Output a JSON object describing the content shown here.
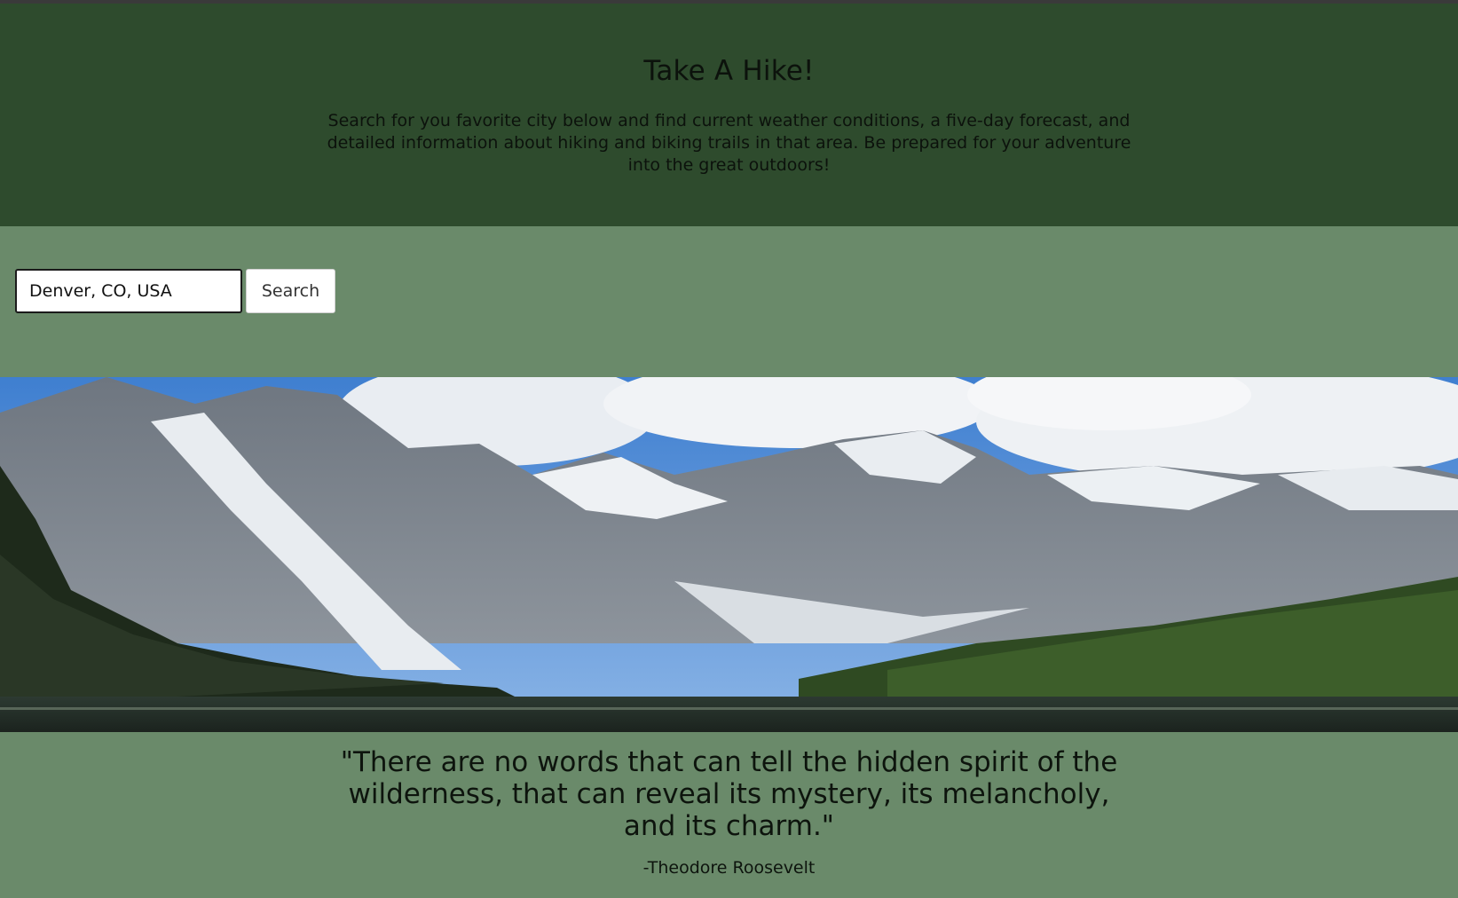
{
  "header": {
    "title": "Take A Hike!",
    "description": "Search for you favorite city below and find current weather conditions, a five-day forecast, and detailed information about hiking and biking trails in that area. Be prepared for your adventure into the great outdoors!"
  },
  "search": {
    "value": "Denver, CO, USA",
    "button_label": "Search"
  },
  "hero": {
    "image": "mountain-lake-landscape"
  },
  "quote": {
    "text": "\"There are no words that can tell the hidden spirit of the wilderness, that can reveal its mystery, its melancholy, and its charm.\"",
    "author": "-Theodore Roosevelt"
  },
  "colors": {
    "header_bg": "#2e4b2d",
    "page_bg": "#6a8a6a"
  }
}
